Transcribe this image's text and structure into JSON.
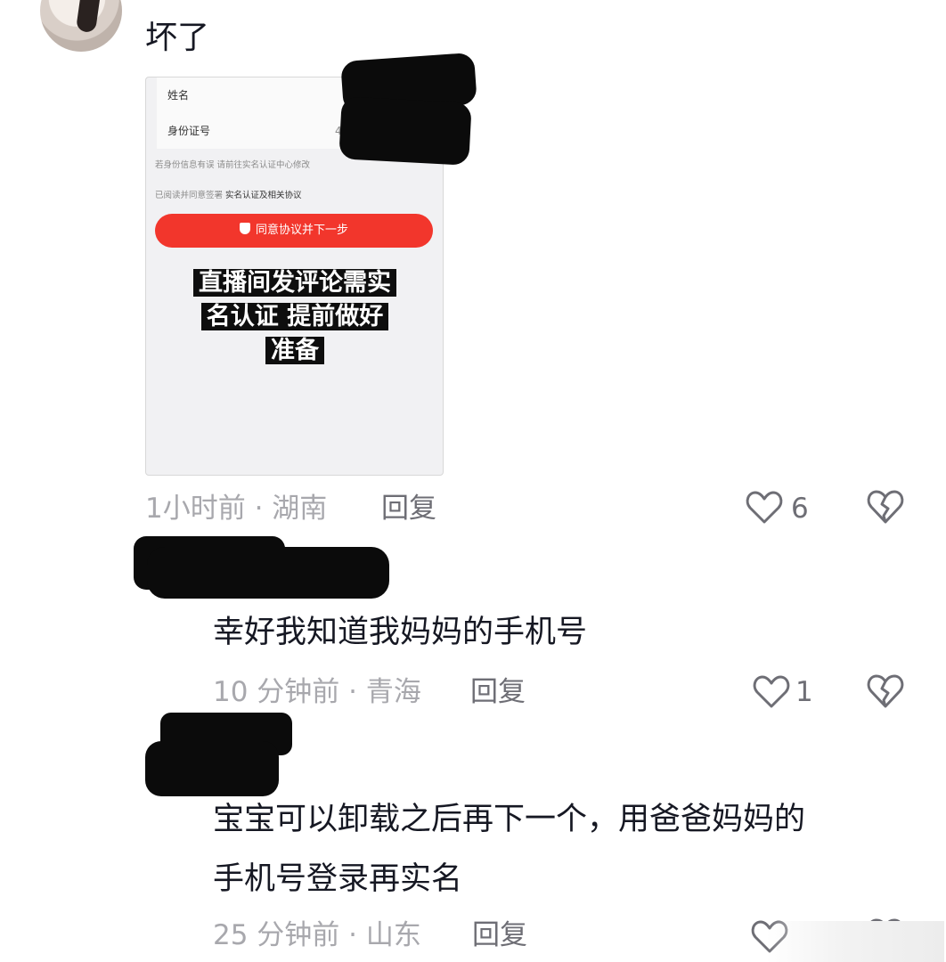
{
  "comment": {
    "text": "坏了",
    "meta": "1小时前 · 湖南",
    "reply_label": "回复",
    "likes": "6"
  },
  "screenshot": {
    "name_label": "姓名",
    "id_label": "身份证号",
    "id_trail": "4*",
    "info_note": "若身份信息有误 请前往实名认证中心修改",
    "agree_prefix": "已阅读并同意签署",
    "agree_link": "实名认证及相关协议",
    "button_label": "同意协议并下一步",
    "caption_lines": [
      "直播间发评论需实",
      "名认证 提前做好",
      "准备"
    ]
  },
  "replies": [
    {
      "text": "幸好我知道我妈妈的手机号",
      "meta": "10 分钟前 · 青海",
      "reply_label": "回复",
      "likes": "1"
    },
    {
      "text_lines": [
        "宝宝可以卸载之后再下一个，用爸爸妈妈的",
        "手机号登录再实名"
      ],
      "meta": "25 分钟前 · 山东",
      "reply_label": "回复",
      "likes": ""
    }
  ],
  "colors": {
    "button_red": "#f2362c",
    "meta_gray": "#a8a8ad",
    "text": "#161823"
  },
  "icons": [
    "heart-icon",
    "broken-heart-icon"
  ]
}
